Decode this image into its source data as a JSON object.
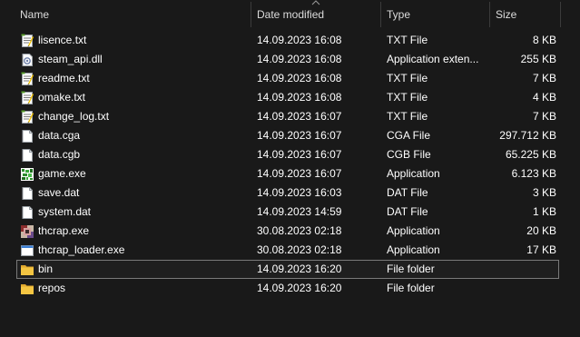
{
  "columns": {
    "name": "Name",
    "date_modified": "Date modified",
    "type": "Type",
    "size": "Size"
  },
  "files": [
    {
      "name": "lisence.txt",
      "date": "14.09.2023 16:08",
      "type": "TXT File",
      "size": "8 KB",
      "icon": "text-file-icon"
    },
    {
      "name": "steam_api.dll",
      "date": "14.09.2023 16:08",
      "type": "Application exten...",
      "size": "255 KB",
      "icon": "dll-file-icon"
    },
    {
      "name": "readme.txt",
      "date": "14.09.2023 16:08",
      "type": "TXT File",
      "size": "7 KB",
      "icon": "text-file-icon"
    },
    {
      "name": "omake.txt",
      "date": "14.09.2023 16:08",
      "type": "TXT File",
      "size": "4 KB",
      "icon": "text-file-icon"
    },
    {
      "name": "change_log.txt",
      "date": "14.09.2023 16:07",
      "type": "TXT File",
      "size": "7 KB",
      "icon": "text-file-icon"
    },
    {
      "name": "data.cga",
      "date": "14.09.2023 16:07",
      "type": "CGA File",
      "size": "297.712 KB",
      "icon": "blank-file-icon"
    },
    {
      "name": "data.cgb",
      "date": "14.09.2023 16:07",
      "type": "CGB File",
      "size": "65.225 KB",
      "icon": "blank-file-icon"
    },
    {
      "name": "game.exe",
      "date": "14.09.2023 16:07",
      "type": "Application",
      "size": "6.123 KB",
      "icon": "game-exe-icon"
    },
    {
      "name": "save.dat",
      "date": "14.09.2023 16:03",
      "type": "DAT File",
      "size": "3 KB",
      "icon": "blank-file-icon"
    },
    {
      "name": "system.dat",
      "date": "14.09.2023 14:59",
      "type": "DAT File",
      "size": "1 KB",
      "icon": "blank-file-icon"
    },
    {
      "name": "thcrap.exe",
      "date": "30.08.2023 02:18",
      "type": "Application",
      "size": "20 KB",
      "icon": "thcrap-exe-icon"
    },
    {
      "name": "thcrap_loader.exe",
      "date": "30.08.2023 02:18",
      "type": "Application",
      "size": "17 KB",
      "icon": "application-window-icon"
    },
    {
      "name": "bin",
      "date": "14.09.2023 16:20",
      "type": "File folder",
      "size": "",
      "icon": "folder-icon",
      "selected": true
    },
    {
      "name": "repos",
      "date": "14.09.2023 16:20",
      "type": "File folder",
      "size": "",
      "icon": "folder-icon"
    }
  ],
  "colors": {
    "background": "#191919",
    "text": "#ffffff",
    "folder": "#f4c542"
  }
}
